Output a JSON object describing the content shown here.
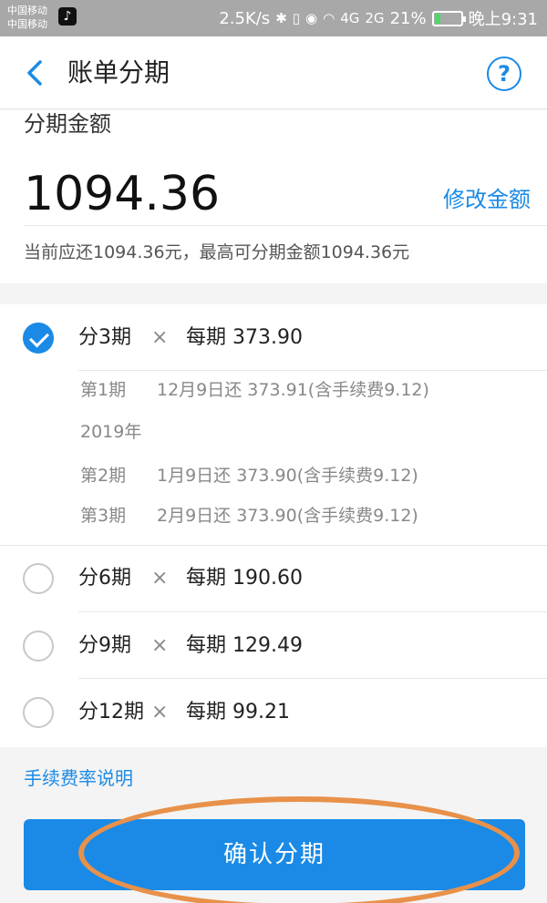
{
  "status_bar": {
    "carrier_1": "中国移动",
    "carrier_2": "中国移动",
    "speed": "2.5K/s",
    "signal_1": "4G",
    "signal_2": "2G",
    "battery_percent": "21%",
    "battery_level": 0.21,
    "time": "晚上9:31"
  },
  "nav": {
    "title": "账单分期",
    "help_symbol": "?"
  },
  "amount": {
    "label": "分期金额",
    "value": "1094.36",
    "edit_label": "修改金额",
    "note": "当前应还1094.36元，最高可分期金额1094.36元"
  },
  "options": [
    {
      "term": "分3期",
      "times": "×",
      "per": "每期 373.90",
      "selected": true
    },
    {
      "term": "分6期",
      "times": "×",
      "per": "每期 190.60",
      "selected": false
    },
    {
      "term": "分9期",
      "times": "×",
      "per": "每期 129.49",
      "selected": false
    },
    {
      "term": "分12期",
      "times": "×",
      "per": "每期 99.21",
      "selected": false
    }
  ],
  "schedule": {
    "year": "2019年",
    "rows": [
      {
        "term": "第1期",
        "detail": "12月9日还 373.91(含手续费9.12)"
      },
      {
        "term": "第2期",
        "detail": "1月9日还 373.90(含手续费9.12)"
      },
      {
        "term": "第3期",
        "detail": "2月9日还 373.90(含手续费9.12)"
      }
    ]
  },
  "fee_link": "手续费率说明",
  "confirm_label": "确认分期",
  "colors": {
    "accent": "#1a8ae6",
    "annotation": "#e8914a"
  }
}
